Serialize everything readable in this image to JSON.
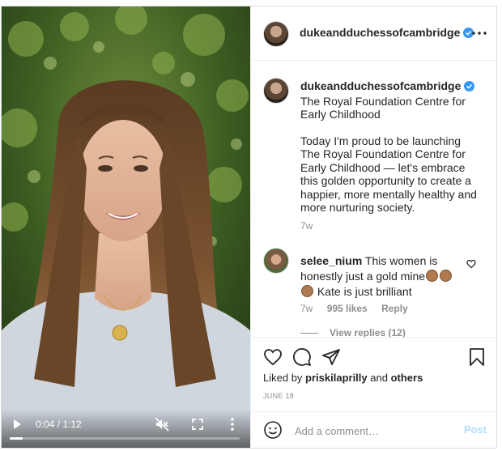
{
  "video": {
    "time": "0:04 / 1:12",
    "progress": 0.056
  },
  "header": {
    "username": "dukeandduchessofcambridge",
    "more_icon": "more-horizontal-icon"
  },
  "caption": {
    "username": "dukeandduchessofcambridge",
    "lead_text": "The Royal Foundation Centre for Early Childhood",
    "body": "Today I'm proud to be launching The Royal Foundation Centre for Early Childhood — let's embrace this golden opportunity to create a happier, more mentally healthy and more nurturing society.",
    "age": "7w"
  },
  "comment": {
    "username": "selee_nium",
    "text_1": "This women is honestly just a gold mine",
    "text_2": "Kate is just brilliant",
    "age": "7w",
    "likes": "995 likes",
    "reply_label": "Reply",
    "view_replies": "View replies (12)"
  },
  "footer": {
    "liked_by_prefix": "Liked by",
    "liked_by_user": "priskilaprilly",
    "liked_by_and": "and",
    "liked_by_others": "others",
    "date": "JUNE 18",
    "comment_placeholder": "Add a comment…",
    "post_label": "Post"
  },
  "colors": {
    "verified": "#3897f0",
    "post_disabled": "#b2dffc",
    "muted": "#8e8e8e",
    "text": "#262626"
  }
}
